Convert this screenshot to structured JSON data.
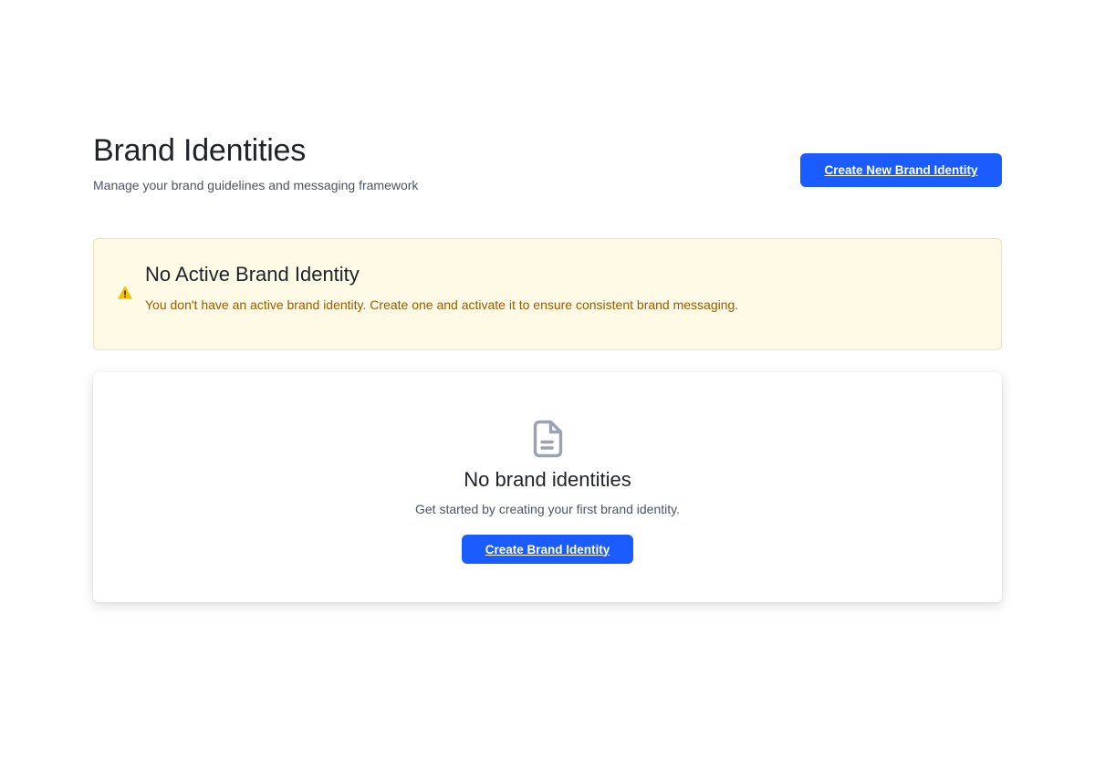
{
  "header": {
    "title": "Brand Identities",
    "subtitle": "Manage your brand guidelines and messaging framework",
    "create_button_label": "Create New Brand Identity"
  },
  "alert": {
    "icon": "warning-triangle-icon",
    "title": "No Active Brand Identity",
    "message": "You don't have an active brand identity. Create one and activate it to ensure consistent brand messaging."
  },
  "empty_state": {
    "icon": "document-icon",
    "title": "No brand identities",
    "message": "Get started by creating your first brand identity.",
    "button_label": "Create Brand Identity"
  },
  "colors": {
    "primary": "#1a5cff",
    "alert_background": "#fefae6",
    "alert_border": "#ede3b6",
    "alert_text": "#9a5a00",
    "warning_icon": "#f5c000",
    "empty_icon": "#9ca3af"
  }
}
